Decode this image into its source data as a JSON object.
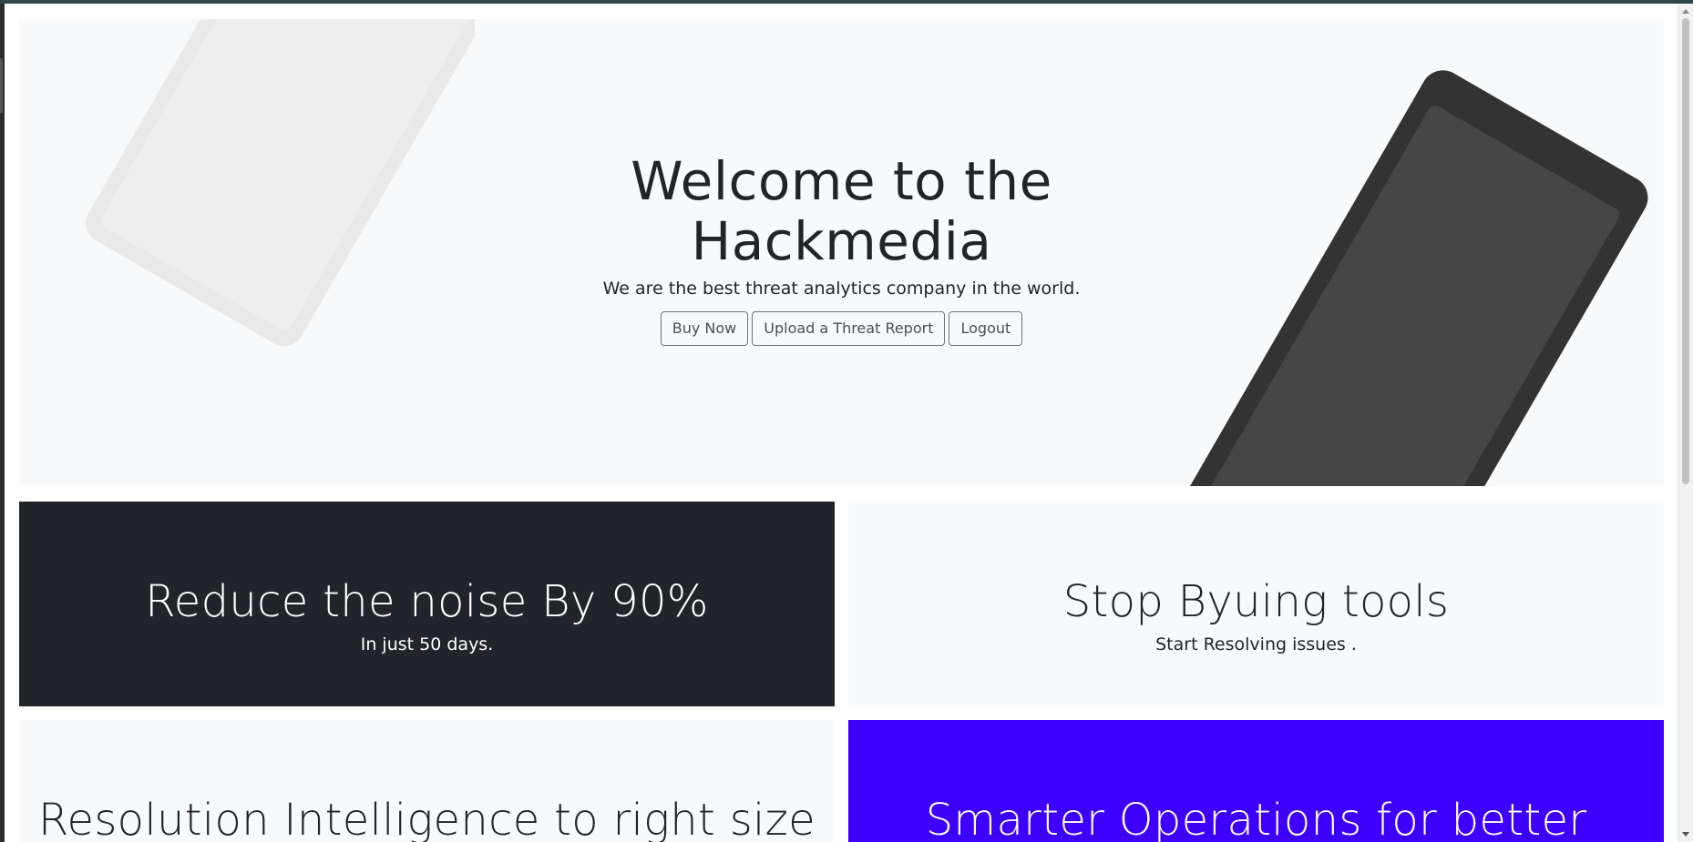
{
  "hero": {
    "title": "Welcome to the Hackmedia",
    "subtitle": "We are the best threat analytics company in the world.",
    "buttons": {
      "buy_now": "Buy Now",
      "upload_report": "Upload a Threat Report",
      "logout": "Logout"
    }
  },
  "features": [
    {
      "title": "Reduce the noise By 90%",
      "subtitle": "In just 50 days.",
      "theme": "dark",
      "bg": "#212529"
    },
    {
      "title": "Stop Byuing tools",
      "subtitle": "Start Resolving issues .",
      "theme": "light",
      "bg": "#f8f9fa"
    },
    {
      "title": "Resolution Intelligence to right size",
      "subtitle": "",
      "theme": "light",
      "bg": "#f8f9fa"
    },
    {
      "title": "Smarter Operations for better",
      "subtitle": "",
      "theme": "blue",
      "bg": "#3d00ff"
    }
  ],
  "icons": {
    "device_left": "tablet-device-illustration",
    "device_right": "phone-device-illustration"
  }
}
